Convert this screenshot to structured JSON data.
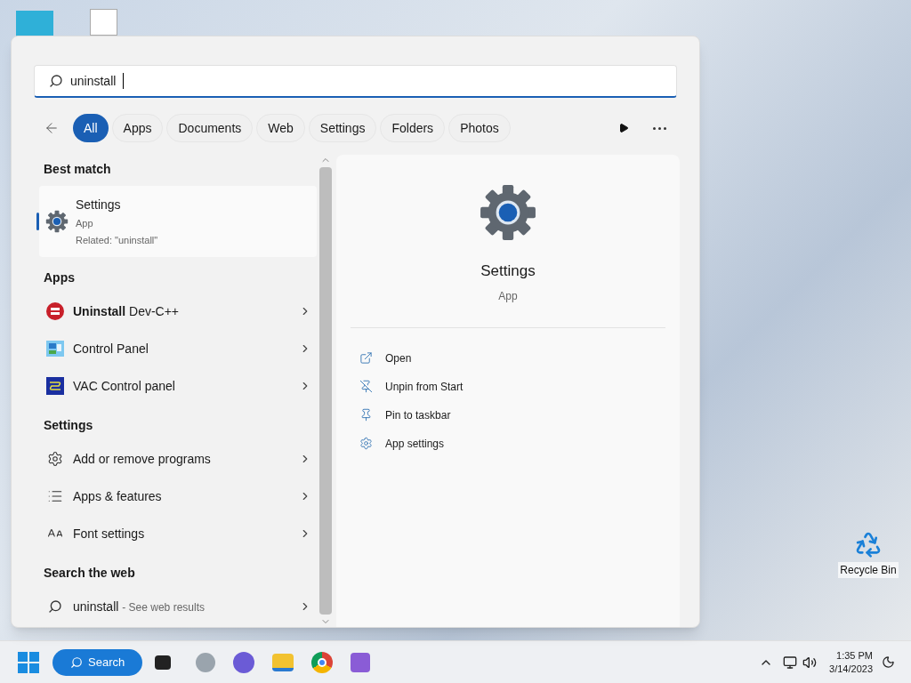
{
  "search": {
    "value": "uninstall"
  },
  "filters": [
    {
      "label": "All",
      "selected": true
    },
    {
      "label": "Apps",
      "selected": false
    },
    {
      "label": "Documents",
      "selected": false
    },
    {
      "label": "Web",
      "selected": false
    },
    {
      "label": "Settings",
      "selected": false
    },
    {
      "label": "Folders",
      "selected": false
    },
    {
      "label": "Photos",
      "selected": false
    }
  ],
  "best_match": {
    "heading": "Best match",
    "title": "Settings",
    "subtitle": "App",
    "related": "Related: \"uninstall\"",
    "selected": true
  },
  "sections": [
    {
      "heading": "Apps",
      "items": [
        {
          "label": "**Uninstall** Dev-C++"
        },
        {
          "label": "Control Panel"
        },
        {
          "label": "VAC Control panel"
        }
      ]
    },
    {
      "heading": "Settings",
      "items": [
        {
          "label": "Add or remove programs"
        },
        {
          "label": "Apps & features"
        },
        {
          "label": "Font settings"
        }
      ]
    }
  ],
  "web": {
    "heading": "Search the web",
    "query": "uninstall",
    "hint": "- See web results"
  },
  "detail": {
    "title": "Settings",
    "subtitle": "App",
    "actions": [
      "Open",
      "Unpin from Start",
      "Pin to taskbar",
      "App settings"
    ]
  },
  "desktop": {
    "icons": [
      {
        "label": "Recycle Bin"
      }
    ]
  },
  "taskbar": {
    "search_label": "Search",
    "time": "1:35 PM",
    "date": "3/14/2023"
  }
}
